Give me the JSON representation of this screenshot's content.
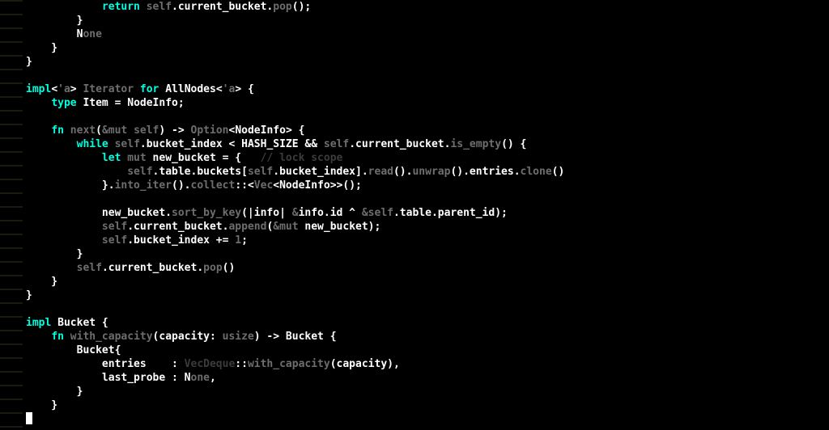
{
  "editor": {
    "lines": [
      [
        {
          "t": "            ",
          "c": "str"
        },
        {
          "t": "return",
          "c": "kw"
        },
        {
          "t": " ",
          "c": "str"
        },
        {
          "t": "self",
          "c": "dim"
        },
        {
          "t": ".current_bucket.",
          "c": "str"
        },
        {
          "t": "pop",
          "c": "dim"
        },
        {
          "t": "();",
          "c": "str"
        }
      ],
      [
        {
          "t": "        }",
          "c": "str"
        }
      ],
      [
        {
          "t": "        ",
          "c": "str"
        },
        {
          "t": "N",
          "c": "str"
        },
        {
          "t": "one",
          "c": "dim"
        }
      ],
      [
        {
          "t": "    }",
          "c": "str"
        }
      ],
      [
        {
          "t": "}",
          "c": "str"
        }
      ],
      [
        {
          "t": "",
          "c": "str"
        }
      ],
      [
        {
          "t": "impl",
          "c": "kw"
        },
        {
          "t": "<",
          "c": "str"
        },
        {
          "t": "'a",
          "c": "dim"
        },
        {
          "t": "> ",
          "c": "str"
        },
        {
          "t": "Iterator",
          "c": "dim"
        },
        {
          "t": " ",
          "c": "str"
        },
        {
          "t": "for",
          "c": "kw"
        },
        {
          "t": " AllNodes<",
          "c": "str"
        },
        {
          "t": "'a",
          "c": "dim"
        },
        {
          "t": "> {",
          "c": "str"
        }
      ],
      [
        {
          "t": "    ",
          "c": "str"
        },
        {
          "t": "type",
          "c": "kw"
        },
        {
          "t": " Item = NodeInfo;",
          "c": "str"
        }
      ],
      [
        {
          "t": "",
          "c": "str"
        }
      ],
      [
        {
          "t": "    ",
          "c": "str"
        },
        {
          "t": "fn",
          "c": "kw"
        },
        {
          "t": " ",
          "c": "str"
        },
        {
          "t": "next",
          "c": "dim"
        },
        {
          "t": "(",
          "c": "str"
        },
        {
          "t": "&mut self",
          "c": "dim"
        },
        {
          "t": ") -> ",
          "c": "str"
        },
        {
          "t": "Option",
          "c": "dim"
        },
        {
          "t": "<NodeInfo> {",
          "c": "str"
        }
      ],
      [
        {
          "t": "        ",
          "c": "str"
        },
        {
          "t": "while",
          "c": "kw"
        },
        {
          "t": " ",
          "c": "str"
        },
        {
          "t": "self",
          "c": "dim"
        },
        {
          "t": ".bucket_index < HASH_SIZE && ",
          "c": "str"
        },
        {
          "t": "self",
          "c": "dim"
        },
        {
          "t": ".current_bucket.",
          "c": "str"
        },
        {
          "t": "is_empty",
          "c": "dim"
        },
        {
          "t": "() {",
          "c": "str"
        }
      ],
      [
        {
          "t": "            ",
          "c": "str"
        },
        {
          "t": "let",
          "c": "kw"
        },
        {
          "t": " ",
          "c": "str"
        },
        {
          "t": "mut",
          "c": "dim"
        },
        {
          "t": " new_bucket = {   ",
          "c": "str"
        },
        {
          "t": "// lock scope",
          "c": "faint"
        }
      ],
      [
        {
          "t": "                ",
          "c": "str"
        },
        {
          "t": "self",
          "c": "dim"
        },
        {
          "t": ".table.buckets[",
          "c": "str"
        },
        {
          "t": "self",
          "c": "dim"
        },
        {
          "t": ".bucket_index].",
          "c": "str"
        },
        {
          "t": "read",
          "c": "dim"
        },
        {
          "t": "().",
          "c": "str"
        },
        {
          "t": "unwrap",
          "c": "dim"
        },
        {
          "t": "().entries.",
          "c": "str"
        },
        {
          "t": "clone",
          "c": "dim"
        },
        {
          "t": "()",
          "c": "str"
        }
      ],
      [
        {
          "t": "            }.",
          "c": "str"
        },
        {
          "t": "into_iter",
          "c": "dim"
        },
        {
          "t": "().",
          "c": "str"
        },
        {
          "t": "collect",
          "c": "dim"
        },
        {
          "t": "::<",
          "c": "str"
        },
        {
          "t": "Vec",
          "c": "dim"
        },
        {
          "t": "<NodeInfo>>();",
          "c": "str"
        }
      ],
      [
        {
          "t": "",
          "c": "str"
        }
      ],
      [
        {
          "t": "            new_bucket.",
          "c": "str"
        },
        {
          "t": "sort_by_key",
          "c": "dim"
        },
        {
          "t": "(|info| ",
          "c": "str"
        },
        {
          "t": "&",
          "c": "dim"
        },
        {
          "t": "info.id ^ ",
          "c": "str"
        },
        {
          "t": "&",
          "c": "dim"
        },
        {
          "t": "self",
          "c": "dim"
        },
        {
          "t": ".table.parent_id);",
          "c": "str"
        }
      ],
      [
        {
          "t": "            ",
          "c": "str"
        },
        {
          "t": "self",
          "c": "dim"
        },
        {
          "t": ".current_bucket.",
          "c": "str"
        },
        {
          "t": "append",
          "c": "dim"
        },
        {
          "t": "(",
          "c": "str"
        },
        {
          "t": "&mut",
          "c": "dim"
        },
        {
          "t": " new_bucket);",
          "c": "str"
        }
      ],
      [
        {
          "t": "            ",
          "c": "str"
        },
        {
          "t": "self",
          "c": "dim"
        },
        {
          "t": ".bucket_index += ",
          "c": "str"
        },
        {
          "t": "1",
          "c": "dim"
        },
        {
          "t": ";",
          "c": "str"
        }
      ],
      [
        {
          "t": "        }",
          "c": "str"
        }
      ],
      [
        {
          "t": "        ",
          "c": "str"
        },
        {
          "t": "self",
          "c": "dim"
        },
        {
          "t": ".current_bucket.",
          "c": "str"
        },
        {
          "t": "pop",
          "c": "dim"
        },
        {
          "t": "()",
          "c": "str"
        }
      ],
      [
        {
          "t": "    }",
          "c": "str"
        }
      ],
      [
        {
          "t": "}",
          "c": "str"
        }
      ],
      [
        {
          "t": "",
          "c": "str"
        }
      ],
      [
        {
          "t": "impl",
          "c": "kw"
        },
        {
          "t": " Bucket {",
          "c": "str"
        }
      ],
      [
        {
          "t": "    ",
          "c": "str"
        },
        {
          "t": "fn",
          "c": "kw"
        },
        {
          "t": " ",
          "c": "str"
        },
        {
          "t": "with_capacity",
          "c": "dim"
        },
        {
          "t": "(capacity: ",
          "c": "str"
        },
        {
          "t": "usize",
          "c": "dim"
        },
        {
          "t": ") -> Bucket {",
          "c": "str"
        }
      ],
      [
        {
          "t": "        Bucket{",
          "c": "str"
        }
      ],
      [
        {
          "t": "            entries    : ",
          "c": "str"
        },
        {
          "t": "VecDeque",
          "c": "faint"
        },
        {
          "t": "::",
          "c": "str"
        },
        {
          "t": "with_capacity",
          "c": "dim"
        },
        {
          "t": "(capacity),",
          "c": "str"
        }
      ],
      [
        {
          "t": "            last_probe : ",
          "c": "str"
        },
        {
          "t": "N",
          "c": "str"
        },
        {
          "t": "one",
          "c": "dim"
        },
        {
          "t": ",",
          "c": "str"
        }
      ],
      [
        {
          "t": "        }",
          "c": "str"
        }
      ],
      [
        {
          "t": "    }",
          "c": "str"
        }
      ]
    ],
    "cursor_line": true
  }
}
